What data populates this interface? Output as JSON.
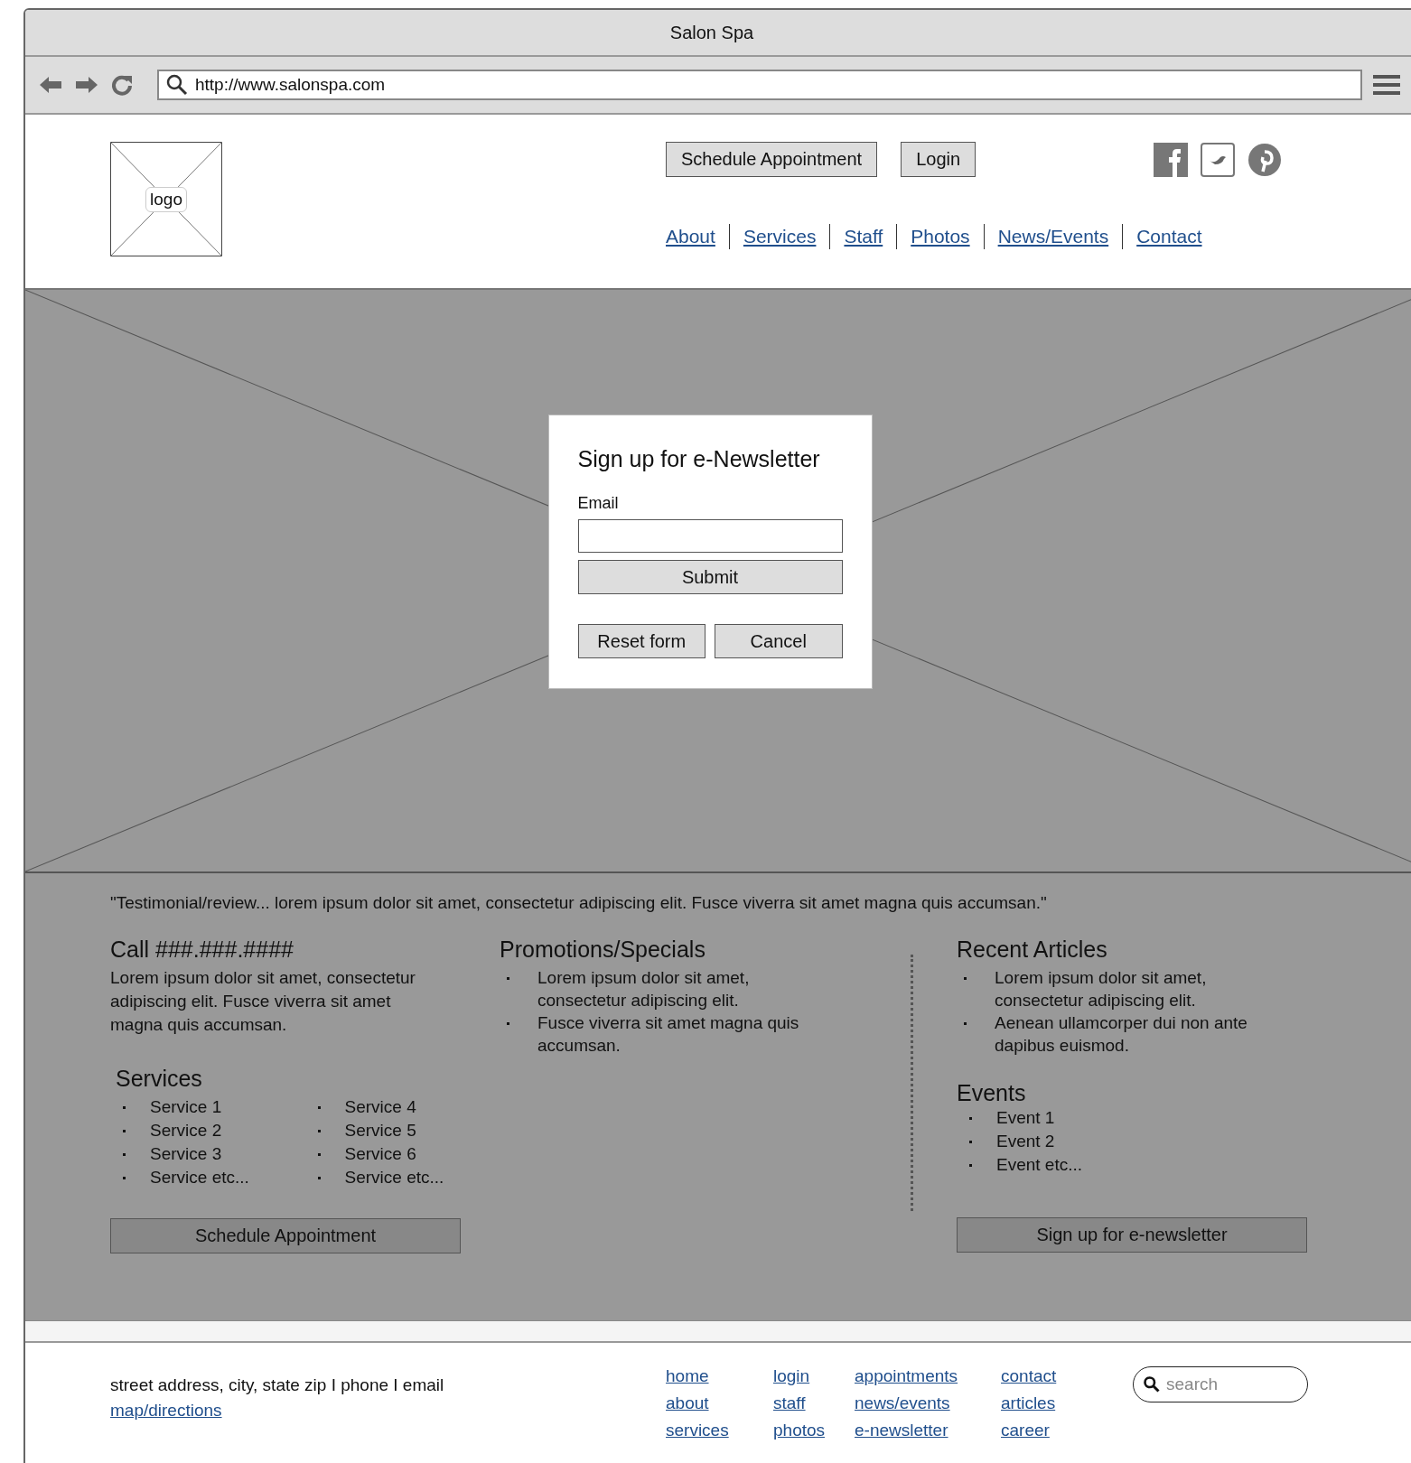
{
  "window": {
    "title": "Salon Spa"
  },
  "browser": {
    "url": "http://www.salonspa.com"
  },
  "header": {
    "logo": "logo",
    "buttons": [
      "Schedule Appointment",
      "Login"
    ],
    "nav": [
      "About",
      "Services",
      "Staff",
      "Photos",
      "News/Events",
      "Contact"
    ]
  },
  "newsletter_dialog": {
    "title": "Sign up for e-Newsletter",
    "email_label": "Email",
    "submit": "Submit",
    "buttons": [
      "Reset form",
      "Cancel"
    ]
  },
  "testimonial": "\"Testimonial/review... lorem ipsum dolor sit amet, consectetur adipiscing elit. Fusce viverra sit amet magna quis accumsan.\"",
  "call": {
    "title": "Call ###.###.####",
    "text": "Lorem ipsum dolor sit amet, consectetur adipiscing elit. Fusce viverra sit amet magna quis accumsan."
  },
  "services": {
    "title": "Services",
    "items": [
      "Service 1",
      "Service 2",
      "Service 3",
      "Service etc...",
      "Service 4",
      "Service 5",
      "Service 6",
      "Service etc..."
    ],
    "button": "Schedule Appointment"
  },
  "promotions": {
    "title": "Promotions/Specials",
    "items": [
      "Lorem ipsum dolor sit amet, consectetur adipiscing elit.",
      "Fusce viverra sit amet magna quis accumsan."
    ]
  },
  "articles": {
    "title": "Recent Articles",
    "items": [
      "Lorem ipsum dolor sit amet, consectetur adipiscing elit.",
      "Aenean ullamcorper dui non ante dapibus euismod."
    ]
  },
  "events": {
    "title": "Events",
    "items": [
      "Event 1",
      "Event 2",
      "Event etc..."
    ],
    "button": "Sign up for e-newsletter"
  },
  "footer": {
    "address": "street address, city, state zip I phone I email",
    "map_link": "map/directions",
    "link_columns": [
      [
        "home",
        "about",
        "services"
      ],
      [
        "login",
        "staff",
        "photos"
      ],
      [
        "appointments",
        "news/events",
        "e-newsletter"
      ],
      [
        "contact",
        "articles",
        "career"
      ]
    ],
    "search": {
      "placeholder": "search"
    }
  }
}
